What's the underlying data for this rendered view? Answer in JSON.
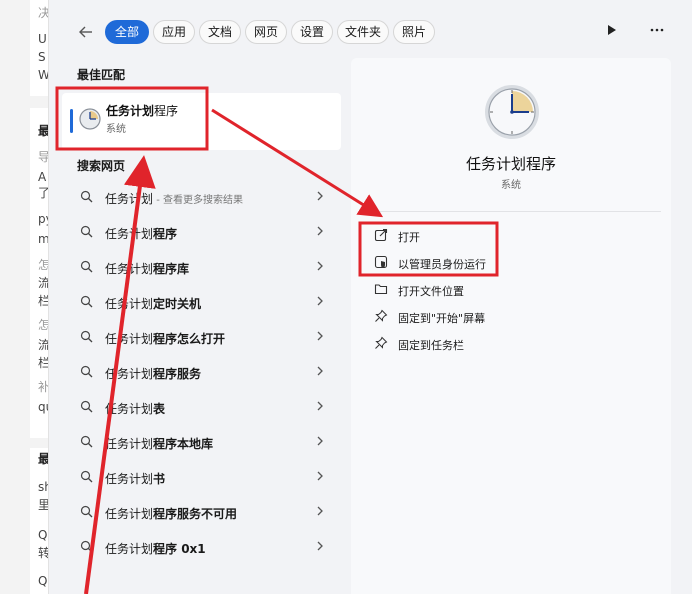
{
  "background_page": {
    "lines": [
      "决",
      "U",
      "S",
      "W",
      "最",
      "导",
      "A",
      "了",
      "py",
      "m",
      "怎",
      "流",
      "栏",
      "怎",
      "流",
      "栏",
      "补",
      "qu",
      "最",
      "sh",
      "里",
      "Q",
      "转",
      "Q"
    ]
  },
  "toolbar": {
    "back_icon": "arrow-left-icon",
    "tabs": [
      "全部",
      "应用",
      "文档",
      "网页",
      "设置",
      "文件夹",
      "照片"
    ],
    "active_tab_index": 0,
    "play_icon": "play-icon",
    "more_icon": "more-horizontal-icon"
  },
  "best_match": {
    "heading": "最佳匹配",
    "name_bold": "任务计划",
    "name_rest": "程序",
    "type": "系统"
  },
  "web_search": {
    "heading": "搜索网页",
    "rows": [
      {
        "prefix": "任务计划",
        "bold": "",
        "hint": " - 查看更多搜索结果"
      },
      {
        "prefix": "任务计划",
        "bold": "程序",
        "hint": ""
      },
      {
        "prefix": "任务计划",
        "bold": "程序库",
        "hint": ""
      },
      {
        "prefix": "任务计划",
        "bold": "定时关机",
        "hint": ""
      },
      {
        "prefix": "任务计划",
        "bold": "程序怎么打开",
        "hint": ""
      },
      {
        "prefix": "任务计划",
        "bold": "程序服务",
        "hint": ""
      },
      {
        "prefix": "任务计划",
        "bold": "表",
        "hint": ""
      },
      {
        "prefix": "任务计划",
        "bold": "程序本地库",
        "hint": ""
      },
      {
        "prefix": "任务计划",
        "bold": "书",
        "hint": ""
      },
      {
        "prefix": "任务计划",
        "bold": "程序服务不可用",
        "hint": ""
      },
      {
        "prefix": "任务计划",
        "bold": "程序 0x1",
        "hint": ""
      }
    ]
  },
  "detail": {
    "app_name": "任务计划程序",
    "app_type": "系统",
    "actions": [
      {
        "label": "打开",
        "icon": "open-external-icon"
      },
      {
        "label": "以管理员身份运行",
        "icon": "shield-admin-icon"
      },
      {
        "label": "打开文件位置",
        "icon": "folder-icon"
      },
      {
        "label": "固定到\"开始\"屏幕",
        "icon": "pin-icon"
      },
      {
        "label": "固定到任务栏",
        "icon": "pin-icon"
      }
    ]
  },
  "colors": {
    "accent": "#1f6ad8",
    "annotation": "#e0242b"
  }
}
